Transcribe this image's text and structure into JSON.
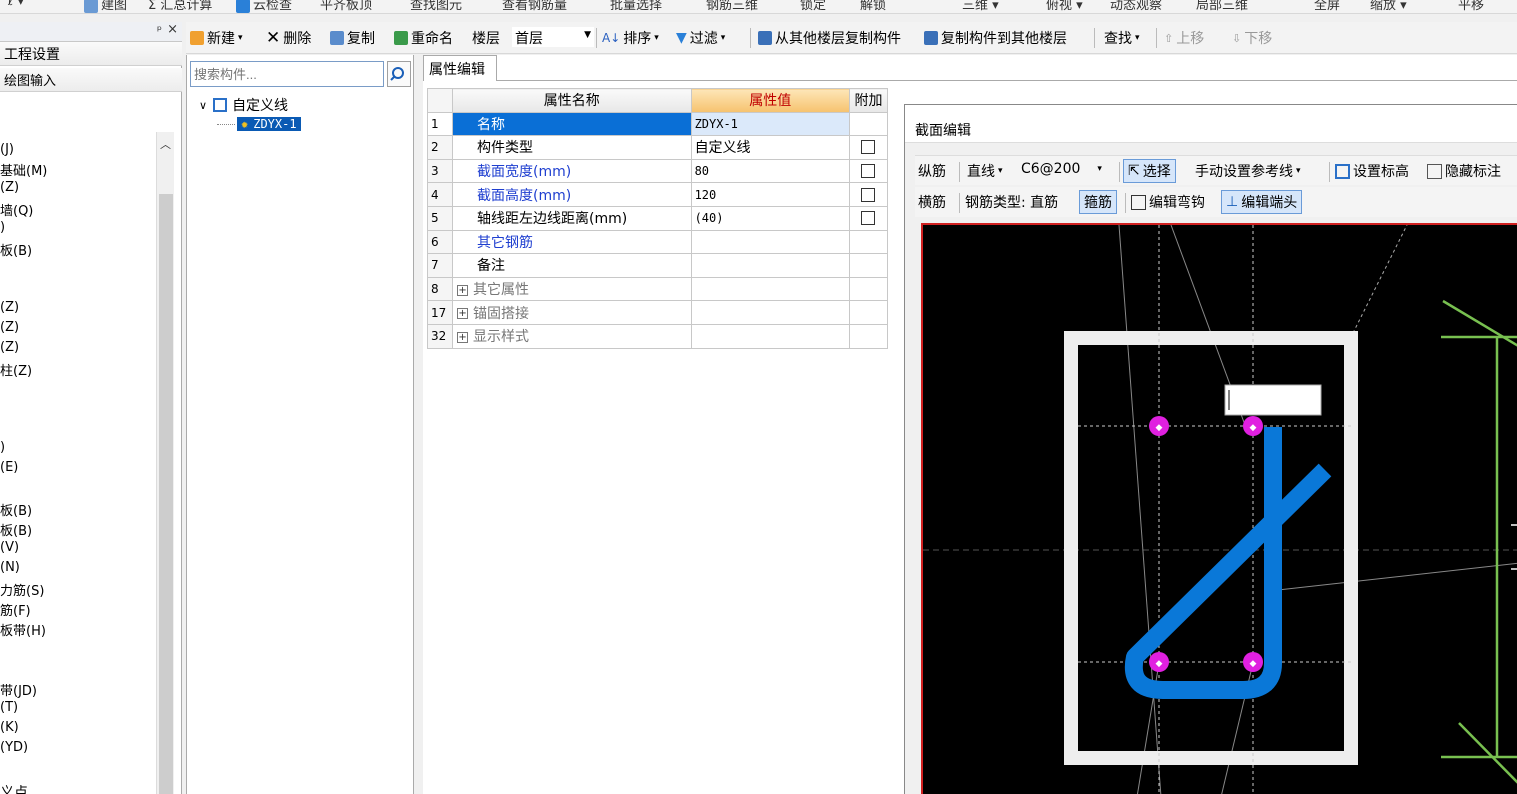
{
  "top_toolbar": {
    "items": [
      "ℓ ▾",
      "建图",
      "Σ 汇总计算",
      "云检查",
      "平齐板顶",
      "查找图元",
      "查看钢筋量",
      "批量选择",
      "钢筋三维",
      "锁定",
      "解锁",
      "三维 ▾",
      "俯视 ▾",
      "动态观察",
      "局部三维",
      "全屏",
      "缩放 ▾",
      "平移"
    ]
  },
  "left_panel": {
    "nav": [
      "工程设置",
      "绘图输入"
    ],
    "items": [
      "(J)",
      "基础(M)",
      "(Z)",
      "墙(Q)",
      ")",
      "板(B)",
      "",
      "",
      "(Z)",
      "(Z)",
      "(Z)",
      "柱(Z)",
      "",
      "",
      "",
      ")",
      "(E)",
      "",
      "",
      "板(B)",
      "板(B)",
      "(V)",
      "(N)",
      "力筋(S)",
      "筋(F)",
      "板带(H)",
      "",
      "",
      "带(JD)",
      "(T)",
      "(K)",
      "(YD)",
      "",
      "",
      "义点"
    ]
  },
  "toolbar": {
    "new": "新建",
    "delete": "删除",
    "copy": "复制",
    "rename": "重命名",
    "floor_label": "楼层",
    "floor_value": "首层",
    "sort": "排序",
    "filter": "过滤",
    "copy_from_floor": "从其他楼层复制构件",
    "copy_to_floor": "复制构件到其他楼层",
    "find": "查找",
    "move_up": "上移",
    "move_down": "下移"
  },
  "tree": {
    "search_placeholder": "搜索构件...",
    "root": "自定义线",
    "child": "ZDYX-1"
  },
  "properties": {
    "tab": "属性编辑",
    "headers": [
      "属性名称",
      "属性值",
      "附加"
    ],
    "rows": [
      {
        "no": "1",
        "name": "名称",
        "value": "ZDYX-1"
      },
      {
        "no": "2",
        "name": "构件类型",
        "value": "自定义线"
      },
      {
        "no": "3",
        "name": "截面宽度(mm)",
        "value": "80"
      },
      {
        "no": "4",
        "name": "截面高度(mm)",
        "value": "120"
      },
      {
        "no": "5",
        "name": "轴线距左边线距离(mm)",
        "value": "(40)"
      },
      {
        "no": "6",
        "name": "其它钢筋",
        "value": ""
      },
      {
        "no": "7",
        "name": "备注",
        "value": ""
      },
      {
        "no": "8",
        "name": "其它属性",
        "value": ""
      },
      {
        "no": "17",
        "name": "锚固搭接",
        "value": ""
      },
      {
        "no": "32",
        "name": "显示样式",
        "value": ""
      }
    ]
  },
  "section_editor": {
    "title": "截面编辑",
    "row1": {
      "longitudinal": "纵筋",
      "line_type": "直线",
      "spec": "C6@200",
      "select": "选择",
      "manual_ref": "手动设置参考线",
      "set_elev": "设置标高",
      "hide_label": "隐藏标注"
    },
    "row2": {
      "transverse": "横筋",
      "type_label": "钢筋类型: 直筋",
      "stirrup": "箍筋",
      "edit_hook": "编辑弯钩",
      "edit_end": "编辑端头"
    }
  },
  "colors": {
    "selection": "#0a6fd6",
    "rebar": "#0a78d8",
    "point": "#e020e0",
    "dim_line": "#78c050",
    "frame": "#eeeeee"
  }
}
